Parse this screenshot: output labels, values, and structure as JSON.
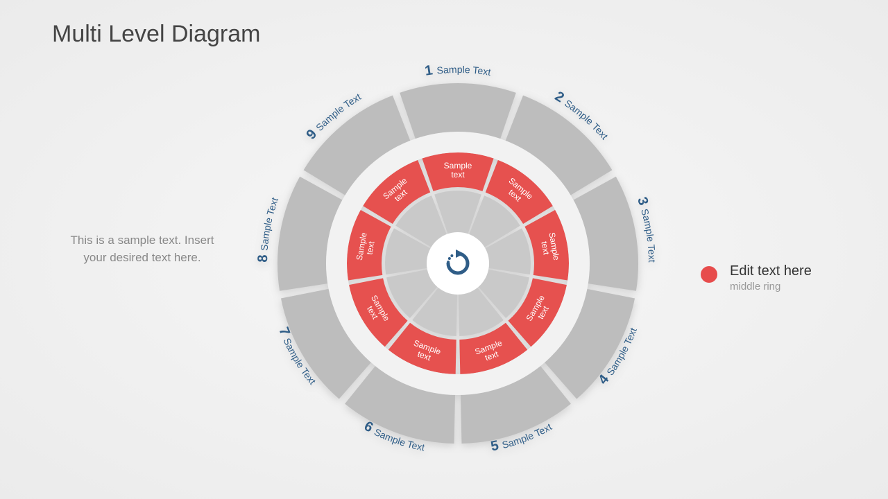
{
  "title": "Multi Level Diagram",
  "left_note": "This is a sample text. Insert your desired text here.",
  "legend": {
    "title": "Edit text here",
    "subtitle": "middle ring",
    "color": "#e74c4c"
  },
  "diagram": {
    "sectors": 9,
    "outer_label": "Sample Text",
    "ring_label_l1": "Sample",
    "ring_label_l2": "text",
    "segments": [
      {
        "n": "1",
        "label": "Sample Text"
      },
      {
        "n": "2",
        "label": "Sample Text"
      },
      {
        "n": "3",
        "label": "Sample Text"
      },
      {
        "n": "4",
        "label": "Sample Text"
      },
      {
        "n": "5",
        "label": "Sample Text"
      },
      {
        "n": "6",
        "label": "Sample Text"
      },
      {
        "n": "7",
        "label": "Sample Text"
      },
      {
        "n": "8",
        "label": "Sample Text"
      },
      {
        "n": "9",
        "label": "Sample Text"
      }
    ],
    "colors": {
      "outer": "#bdbdbd",
      "inner": "#c9c9c9",
      "middle": "#e6514f"
    }
  }
}
